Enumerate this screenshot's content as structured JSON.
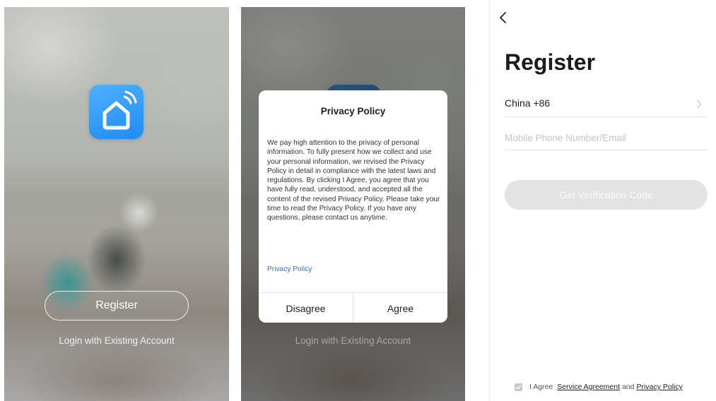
{
  "welcome": {
    "register_label": "Register",
    "login_label": "Login with Existing Account",
    "app_icon": "smart-home-house-icon"
  },
  "privacy_dialog": {
    "title": "Privacy Policy",
    "body": "We pay high attention to the privacy of personal information. To fully present how we collect and use your personal information, we revised the Privacy Policy in detail in compliance with the latest laws and regulations. By clicking I Agree, you agree that you have fully read, understood, and accepted all the content of the revised Privacy Policy. Please take your time to read the Privacy Policy. If you have any questions, please contact us anytime.",
    "link_label": "Privacy Policy",
    "disagree_label": "Disagree",
    "agree_label": "Agree",
    "background_login_label": "Login with Existing Account"
  },
  "register_form": {
    "back_icon": "chevron-left-icon",
    "title": "Register",
    "country": "China +86",
    "phone_placeholder": "Mobile Phone Number/Email",
    "verify_button": "Get Verification Code",
    "agree_prefix": "I Agree",
    "service_agreement": "Service Agreement",
    "and_text": "and",
    "privacy_policy": "Privacy Policy"
  },
  "colors": {
    "accent_blue": "#2a73c9",
    "icon_blue": "#1f8cf0",
    "disabled_button": "#e3e3e3"
  }
}
